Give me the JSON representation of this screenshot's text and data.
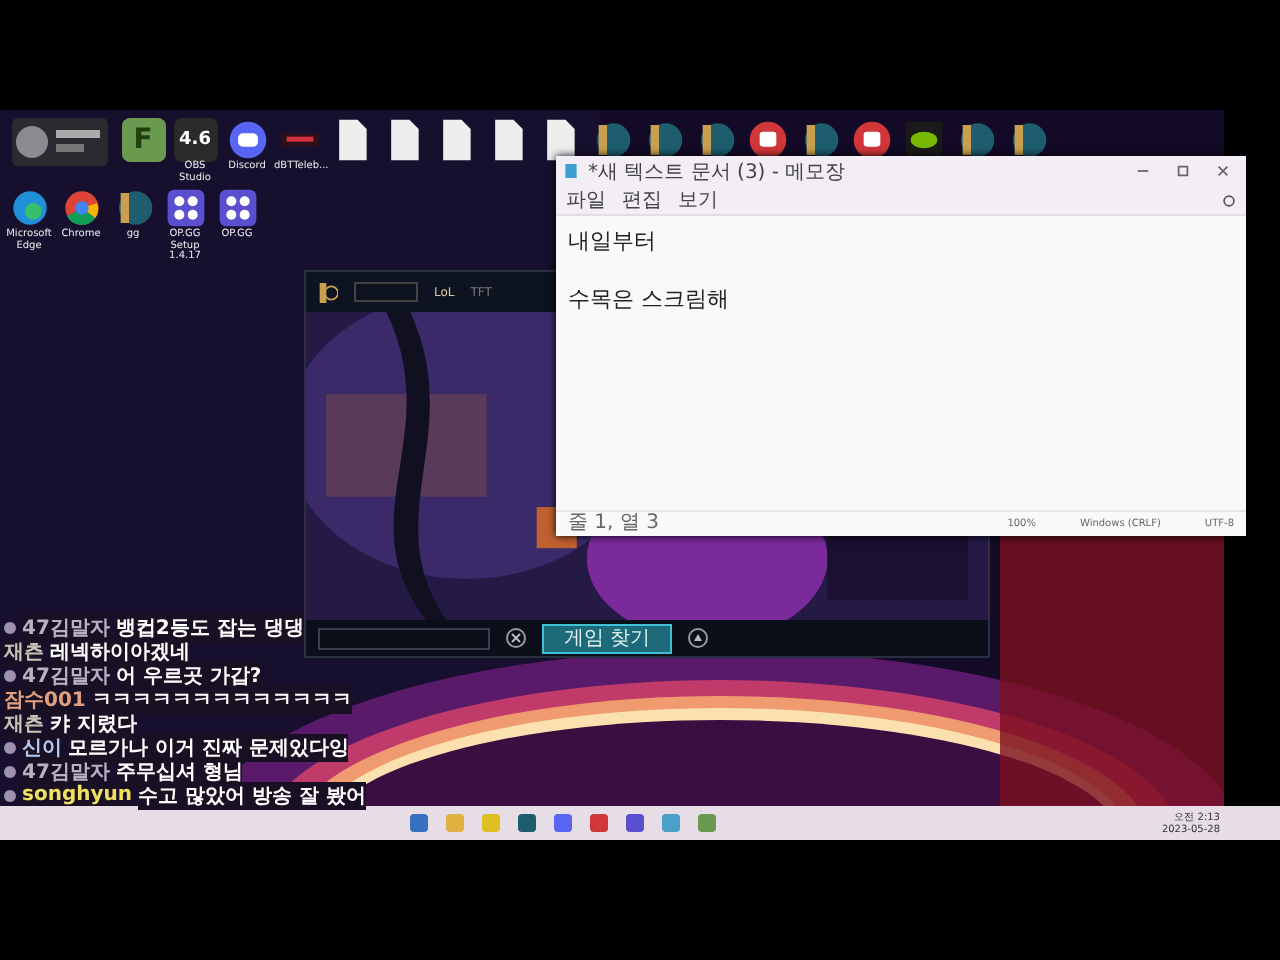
{
  "desktop": {
    "top_icons": [
      {
        "kind": "widget"
      },
      {
        "kind": "letter",
        "glyph": "F"
      },
      {
        "kind": "rating",
        "glyph": "4.6",
        "label": "OBS Studio"
      },
      {
        "kind": "discord",
        "label": "Discord"
      },
      {
        "kind": "banner",
        "label": "dBTTeleb..."
      },
      {
        "kind": "doc"
      },
      {
        "kind": "doc"
      },
      {
        "kind": "doc"
      },
      {
        "kind": "doc"
      },
      {
        "kind": "doc"
      },
      {
        "kind": "lol"
      },
      {
        "kind": "lol"
      },
      {
        "kind": "lol"
      },
      {
        "kind": "riot"
      },
      {
        "kind": "lol"
      },
      {
        "kind": "riot"
      },
      {
        "kind": "nvidia"
      },
      {
        "kind": "lol"
      },
      {
        "kind": "lol"
      }
    ],
    "second_icons": [
      {
        "kind": "edge",
        "label": "Microsoft Edge"
      },
      {
        "kind": "chrome",
        "label": "Chrome"
      },
      {
        "kind": "lol",
        "label": "gg"
      },
      {
        "kind": "opgg",
        "label": "OP.GG Setup 1.4.17"
      },
      {
        "kind": "opgg",
        "label": "OP.GG"
      }
    ]
  },
  "game_client": {
    "tabs": [
      {
        "label": "LoL",
        "selected": true
      },
      {
        "label": "TFT",
        "selected": false
      }
    ],
    "find_match": "게임 찾기"
  },
  "notepad": {
    "title": "*새 텍스트 문서 (3) - 메모장",
    "menu": [
      "파일",
      "편집",
      "보기"
    ],
    "lines": [
      "내일부터",
      "수목은 스크림해"
    ],
    "status": [
      "줄 1, 열 3",
      "100%",
      "Windows (CRLF)",
      "UTF-8"
    ]
  },
  "chat": [
    {
      "user": "47김말자",
      "color": "#b9b2c4",
      "avatar": true,
      "message": "뱅컵2등도 잡는 댕댕"
    },
    {
      "user": "재츤",
      "color": "#c9c2b8",
      "avatar": false,
      "message": "레넥하이아겠네"
    },
    {
      "user": "47김말자",
      "color": "#b9b2c4",
      "avatar": true,
      "message": "어 우르곳 가갑?"
    },
    {
      "user": "잠수001",
      "color": "#e0a080",
      "avatar": false,
      "message": "ㅋㅋㅋㅋㅋㅋㅋㅋㅋㅋㅋㅋㅋ"
    },
    {
      "user": "재츤",
      "color": "#c9c2b8",
      "avatar": false,
      "message": "캬 지렸다"
    },
    {
      "user": "신이",
      "color": "#b6c8f0",
      "avatar": true,
      "message": "모르가나 이거 진짜 문제있다잉"
    },
    {
      "user": "47김말자",
      "color": "#b9b2c4",
      "avatar": true,
      "message": "주무십셔 형님"
    },
    {
      "user": "songhyun",
      "color": "#f0e060",
      "avatar": true,
      "message": "수고 많았어 방송 잘 봤어"
    }
  ],
  "taskbar": {
    "apps": [
      {
        "kind": "mail"
      },
      {
        "kind": "folder"
      },
      {
        "kind": "chrome"
      },
      {
        "kind": "lol"
      },
      {
        "kind": "discord"
      },
      {
        "kind": "riot"
      },
      {
        "kind": "opgg"
      },
      {
        "kind": "notepad"
      },
      {
        "kind": "letter"
      }
    ],
    "time": "오전 2:13",
    "date": "2023-05-28"
  }
}
